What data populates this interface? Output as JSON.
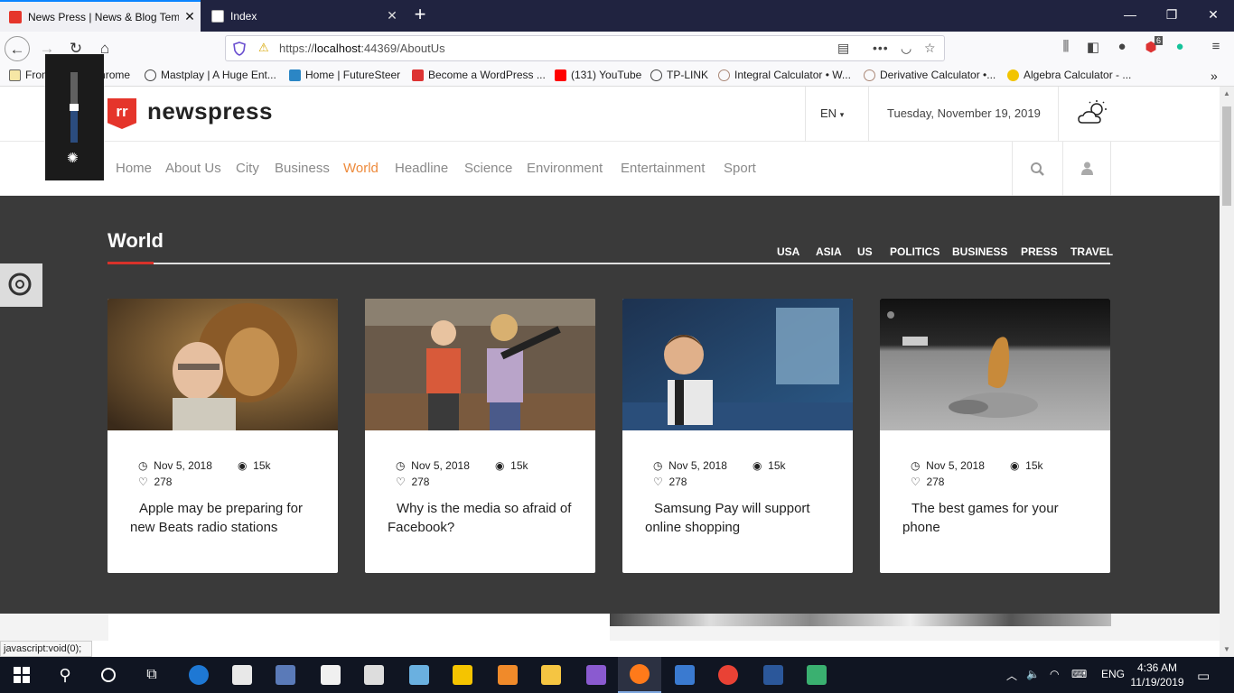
{
  "browser": {
    "tabs": [
      {
        "title": "News Press | News & Blog Temp",
        "active": true
      },
      {
        "title": "Index",
        "active": false
      }
    ],
    "url_prefix": "https://",
    "url_host": "localhost",
    "url_rest": ":44369/AboutUs",
    "bookmarks": [
      "From Google Chrome",
      "Mastplay | A Huge Ent...",
      "Home | FutureSteer",
      "Become a WordPress ...",
      "(131) YouTube",
      "TP-LINK",
      "Integral Calculator • W...",
      "Derivative Calculator •...",
      "Algebra Calculator - ..."
    ],
    "addon_badge": "6",
    "status_text": "javascript:void(0);"
  },
  "site": {
    "logo_mark": "rr",
    "logo_text": "newspress",
    "language": "EN",
    "date": "Tuesday, November 19, 2019",
    "menu": [
      "Home",
      "About Us",
      "City",
      "Business",
      "World",
      "Headline",
      "Science",
      "Environment",
      "Entertainment",
      "Sport"
    ],
    "active_menu": "World"
  },
  "world": {
    "title": "World",
    "subnav": [
      "USA",
      "ASIA",
      "US",
      "POLITICS",
      "BUSINESS",
      "PRESS",
      "TRAVEL"
    ],
    "cards": [
      {
        "date": "Nov 5, 2018",
        "views": "15k",
        "likes": "278",
        "title": "Apple may be preparing for new Beats radio stations"
      },
      {
        "date": "Nov 5, 2018",
        "views": "15k",
        "likes": "278",
        "title": "Why is the media so afraid of Facebook?"
      },
      {
        "date": "Nov 5, 2018",
        "views": "15k",
        "likes": "278",
        "title": "Samsung Pay will support online shopping"
      },
      {
        "date": "Nov 5, 2018",
        "views": "15k",
        "likes": "278",
        "title": "The best games for your phone"
      }
    ]
  },
  "taskbar": {
    "lang": "ENG",
    "time": "4:36 AM",
    "date": "11/19/2019"
  },
  "colors": {
    "accent": "#ed8a3b",
    "brand_red": "#e5352b",
    "world_bg": "#3a3a3a"
  }
}
